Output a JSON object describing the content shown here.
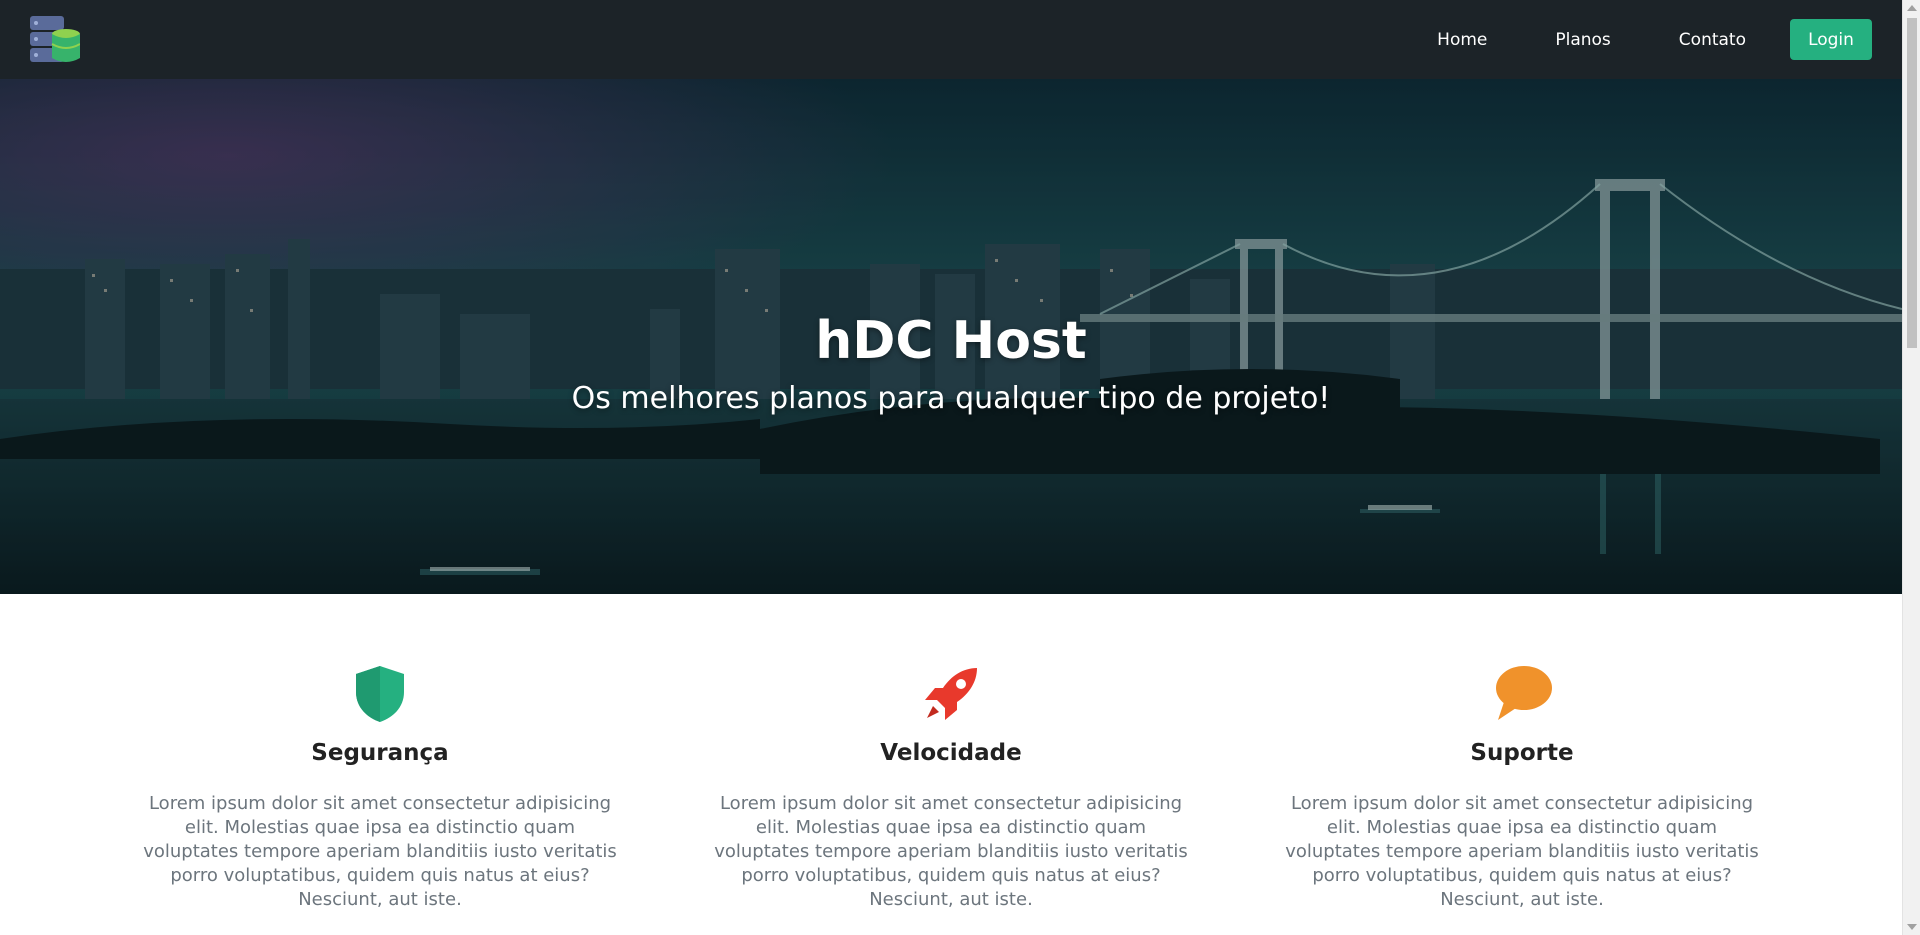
{
  "navbar": {
    "logo_icon": "server-database-icon",
    "links": [
      {
        "label": "Home"
      },
      {
        "label": "Planos"
      },
      {
        "label": "Contato"
      }
    ],
    "login_label": "Login"
  },
  "hero": {
    "title": "hDC Host",
    "subtitle": "Os melhores planos para qualquer tipo de projeto!"
  },
  "features": [
    {
      "icon": "shield-icon",
      "icon_color": "#25b080",
      "title": "Segurança",
      "text": "Lorem ipsum dolor sit amet consectetur adipisicing elit. Molestias quae ipsa ea distinctio quam voluptates tempore aperiam blanditiis iusto veritatis porro voluptatibus, quidem quis natus at eius? Nesciunt, aut iste."
    },
    {
      "icon": "rocket-icon",
      "icon_color": "#e8392c",
      "title": "Velocidade",
      "text": "Lorem ipsum dolor sit amet consectetur adipisicing elit. Molestias quae ipsa ea distinctio quam voluptates tempore aperiam blanditiis iusto veritatis porro voluptatibus, quidem quis natus at eius? Nesciunt, aut iste."
    },
    {
      "icon": "chat-bubble-icon",
      "icon_color": "#f0922b",
      "title": "Suporte",
      "text": "Lorem ipsum dolor sit amet consectetur adipisicing elit. Molestias quae ipsa ea distinctio quam voluptates tempore aperiam blanditiis iusto veritatis porro voluptatibus, quidem quis natus at eius? Nesciunt, aut iste."
    }
  ],
  "colors": {
    "navbar_bg": "#1c2328",
    "accent": "#25b080"
  }
}
